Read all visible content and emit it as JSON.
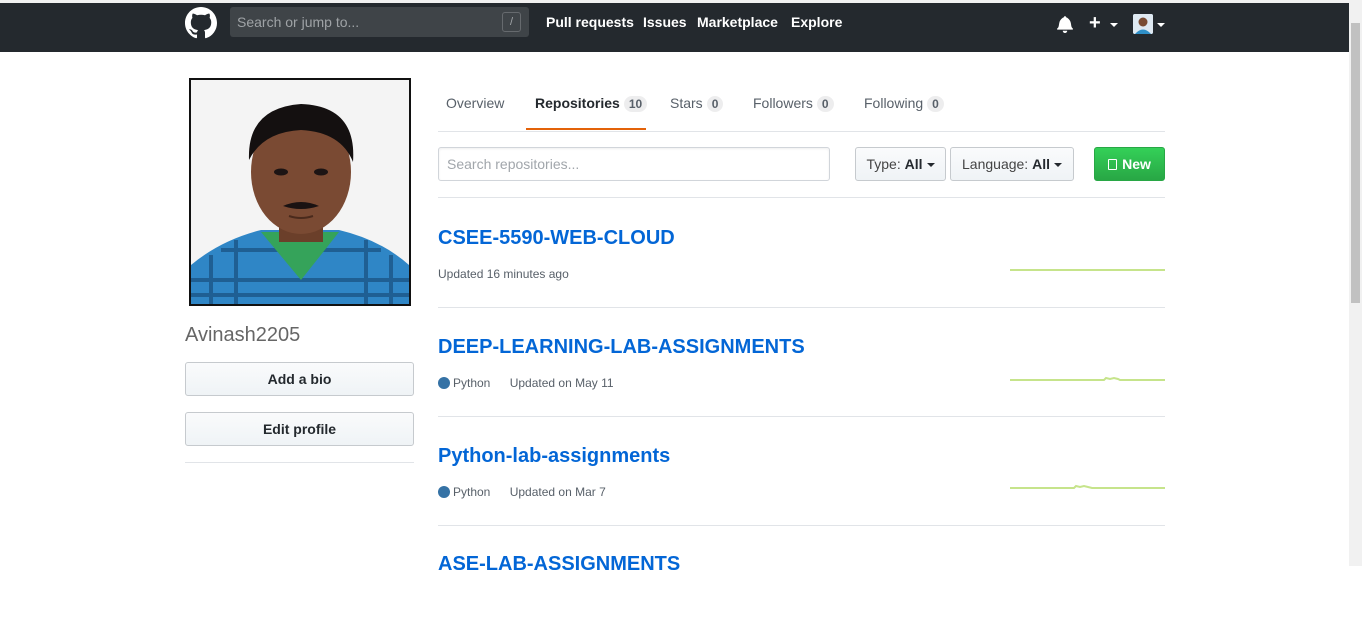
{
  "header": {
    "search_placeholder": "Search or jump to...",
    "search_shortcut": "/",
    "nav": [
      "Pull requests",
      "Issues",
      "Marketplace",
      "Explore"
    ],
    "plus_label": "+"
  },
  "profile": {
    "username": "Avinash2205",
    "add_bio_label": "Add a bio",
    "edit_profile_label": "Edit profile"
  },
  "tabs": [
    {
      "label": "Overview",
      "count": ""
    },
    {
      "label": "Repositories",
      "count": "10"
    },
    {
      "label": "Stars",
      "count": "0"
    },
    {
      "label": "Followers",
      "count": "0"
    },
    {
      "label": "Following",
      "count": "0"
    }
  ],
  "filters": {
    "search_placeholder": "Search repositories...",
    "type_label": "Type:",
    "type_value": "All",
    "language_label": "Language:",
    "language_value": "All",
    "new_label": "New"
  },
  "repos": [
    {
      "name": "CSEE-5590-WEB-CLOUD",
      "language": "",
      "updated": "Updated 16 minutes ago"
    },
    {
      "name": "DEEP-LEARNING-LAB-ASSIGNMENTS",
      "language": "Python",
      "updated": "Updated on May 11"
    },
    {
      "name": "Python-lab-assignments",
      "language": "Python",
      "updated": "Updated on Mar 7"
    },
    {
      "name": "ASE-LAB-ASSIGNMENTS",
      "language": "",
      "updated": ""
    }
  ],
  "colors": {
    "header_bg": "#24292e",
    "link": "#0366d6",
    "python": "#3572A5",
    "new_button": "#28a745",
    "tab_underline": "#e36209",
    "sparkline": "#c6e48b"
  }
}
